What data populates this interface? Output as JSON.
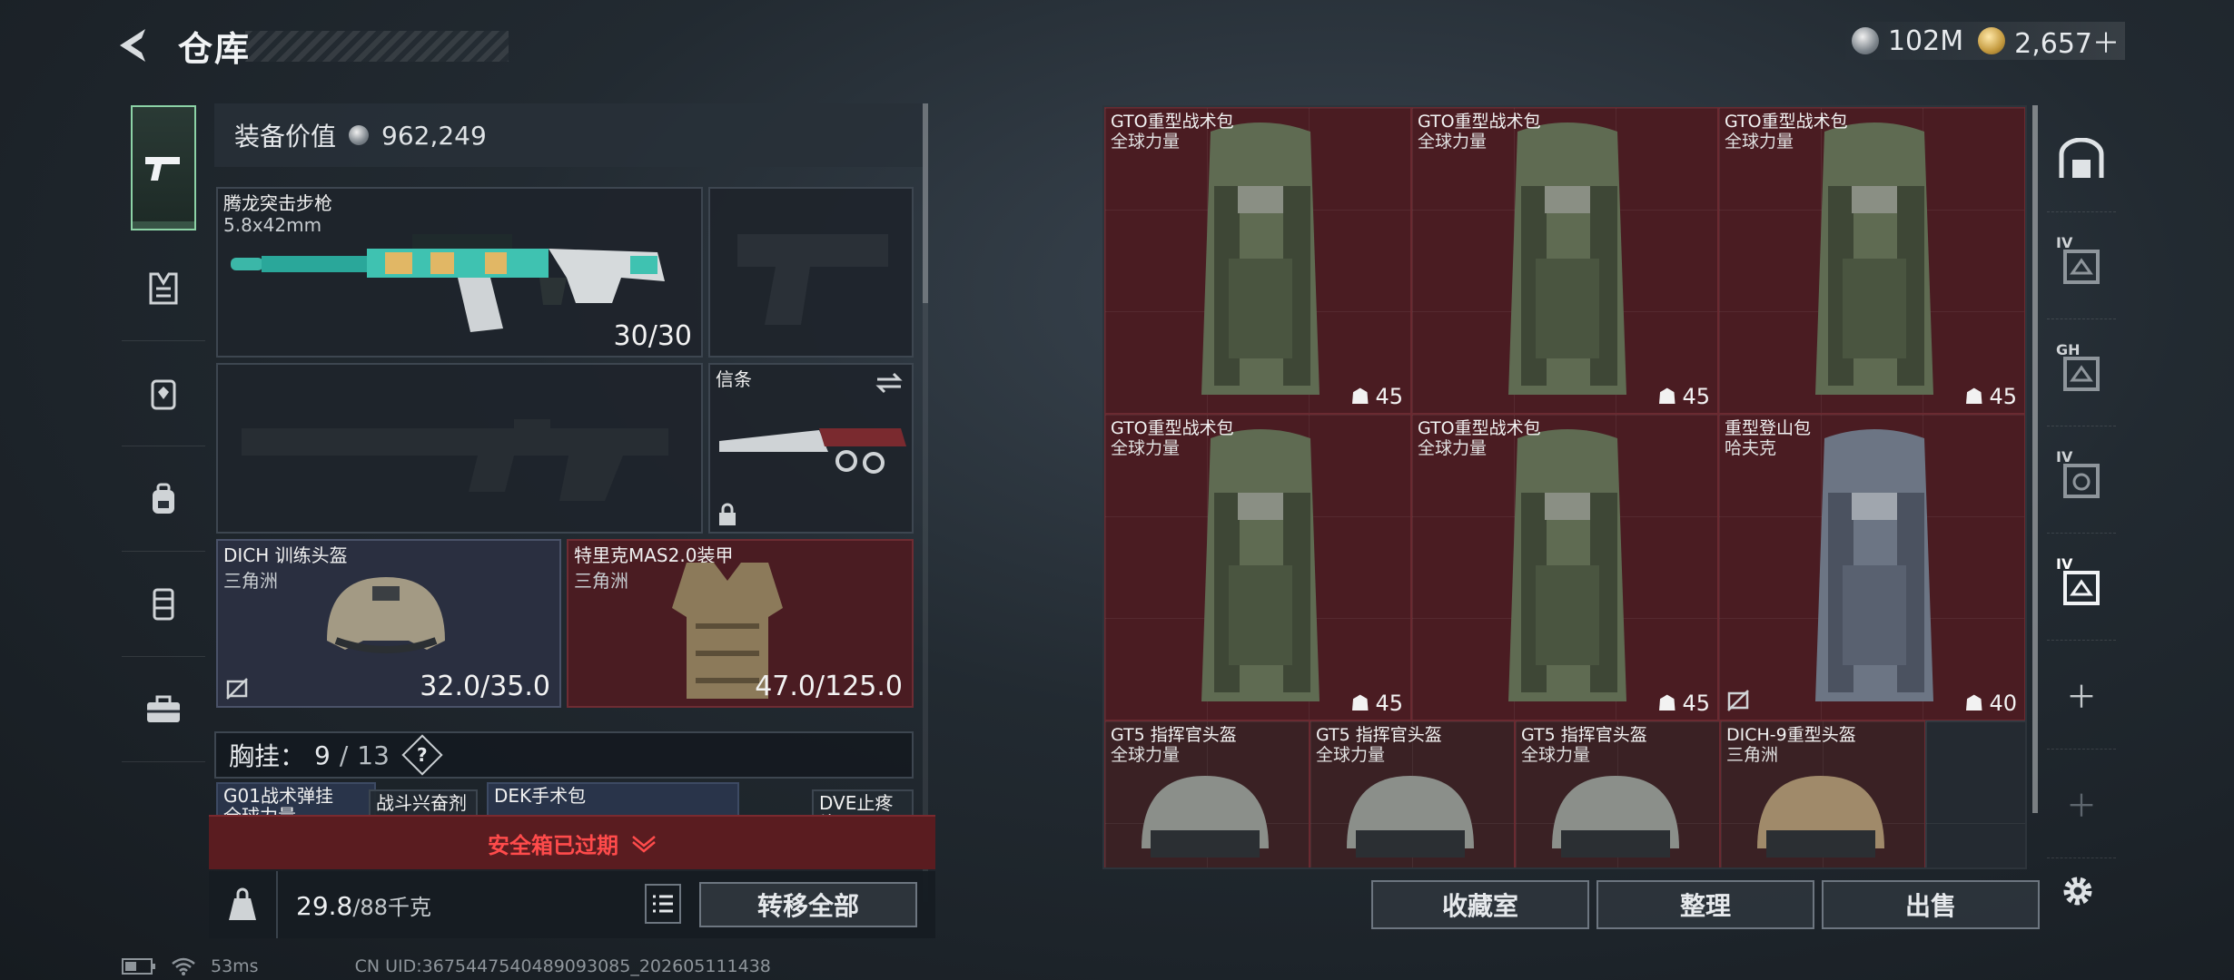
{
  "header": {
    "title": "仓库",
    "back_icon": "back-arrow-icon"
  },
  "currency": {
    "silver": "102M",
    "gold": "2,657＋"
  },
  "categories": [
    "pistol-icon",
    "vest-icon",
    "armor-icon",
    "backpack-icon",
    "rig-icon",
    "case-icon"
  ],
  "loadout": {
    "value_label": "装备价值",
    "value": "962,249",
    "primary": {
      "name": "腾龙突击步枪",
      "caliber": "5.8x42mm",
      "ammo": "30/30"
    },
    "melee": {
      "name": "信条"
    },
    "helmet": {
      "name": "DICH 训练头盔",
      "brand": "三角洲",
      "durability": "32.0/35.0"
    },
    "armor": {
      "name": "特里克MAS2.0装甲",
      "brand": "三角洲",
      "durability": "47.0/125.0"
    },
    "rig": {
      "label": "胸挂：",
      "count": "9",
      "total": "13",
      "help": "?"
    },
    "rig_items": [
      {
        "line1": "G01战术弹挂",
        "line2": "全球力量"
      },
      {
        "line1": "战斗兴奋剂",
        "line2": ""
      },
      {
        "line1": "DEK手术包",
        "line2": ""
      },
      {
        "line1": "DVE止疼片",
        "line2": ""
      }
    ],
    "expired": "安全箱已过期",
    "weight": {
      "current": "29.8",
      "max": "/88千克"
    },
    "transfer_all": "转移全部"
  },
  "storage": {
    "bags": [
      {
        "name": "GTO重型战术包",
        "brand": "全球力量",
        "count": "45",
        "color": "green"
      },
      {
        "name": "GTO重型战术包",
        "brand": "全球力量",
        "count": "45",
        "color": "green"
      },
      {
        "name": "GTO重型战术包",
        "brand": "全球力量",
        "count": "45",
        "color": "green"
      },
      {
        "name": "GTO重型战术包",
        "brand": "全球力量",
        "count": "45",
        "color": "green"
      },
      {
        "name": "GTO重型战术包",
        "brand": "全球力量",
        "count": "45",
        "color": "green"
      },
      {
        "name": "重型登山包",
        "brand": "哈夫克",
        "count": "40",
        "color": "grey"
      }
    ],
    "helmets": [
      {
        "name": "GT5 指挥官头盔",
        "brand": "全球力量"
      },
      {
        "name": "GT5 指挥官头盔",
        "brand": "全球力量"
      },
      {
        "name": "GT5 指挥官头盔",
        "brand": "全球力量"
      },
      {
        "name": "DICH-9重型头盔",
        "brand": "三角洲"
      }
    ]
  },
  "tabs": [
    {
      "lvl": "",
      "icon": "vault-icon"
    },
    {
      "lvl": "IV",
      "icon": "container-icon"
    },
    {
      "lvl": "GH",
      "icon": "container-icon"
    },
    {
      "lvl": "IV",
      "icon": "container-icon"
    },
    {
      "lvl": "IV",
      "icon": "container-icon"
    }
  ],
  "buttons": {
    "collection": "收藏室",
    "organize": "整理",
    "sell": "出售"
  },
  "footer": {
    "ping": "53ms",
    "uid": "CN UID:3675447540489093085_202605111438"
  }
}
